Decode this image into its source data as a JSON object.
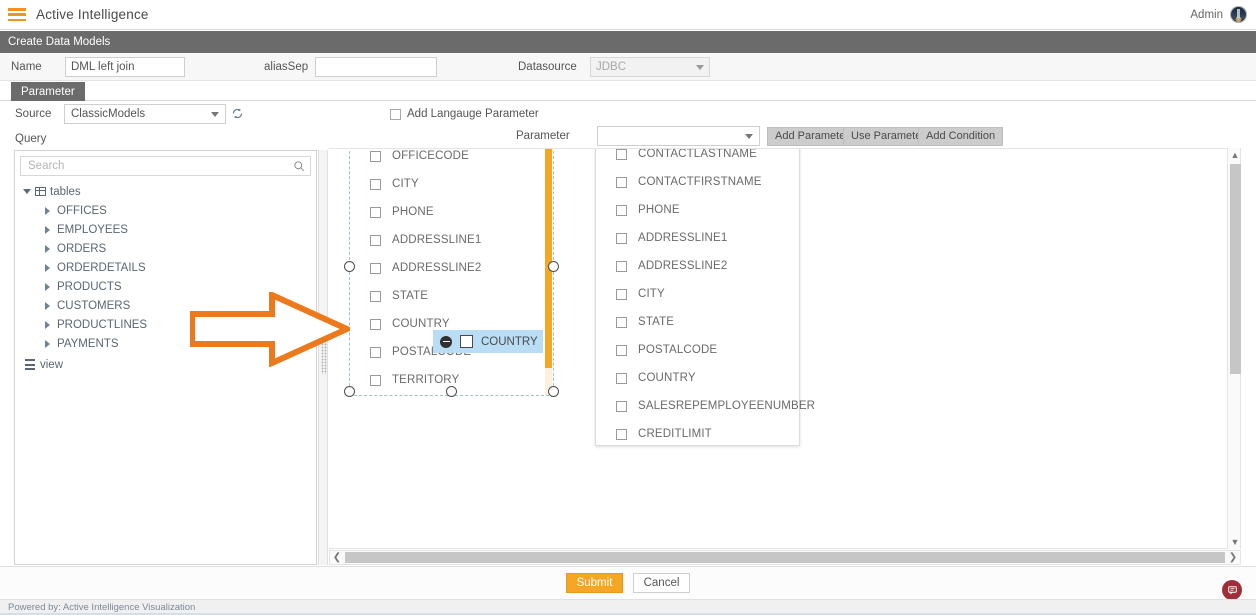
{
  "topbar": {
    "menu_icon": "hamburger-icon",
    "app_title": "Active Intelligence",
    "user_label": "Admin",
    "avatar_icon": "user-avatar"
  },
  "subheader": {
    "title": "Create Data Models"
  },
  "formrow": {
    "name_label": "Name",
    "name_value": "DML left join",
    "aliassep_label": "aliasSep",
    "aliassep_value": "",
    "aliassep_placeholder": "",
    "datasource_label": "Datasource",
    "datasource_value": "JDBC",
    "datasource_disabled": true
  },
  "tabs": {
    "active": "Parameter"
  },
  "band": {
    "source_label": "Source",
    "source_value": "ClassicModels",
    "refresh_icon": "refresh-icon",
    "query_label": "Query",
    "add_language_parameter_label": "Add Langauge Parameter",
    "add_language_parameter_checked": false,
    "parameter_label": "Parameter",
    "parameter_value": "",
    "buttons": [
      {
        "label": "Add Parameter"
      },
      {
        "label": "Use Parameter"
      },
      {
        "label": "Add Condition"
      }
    ]
  },
  "tree": {
    "search_placeholder": "Search",
    "search_value": "",
    "search_icon": "search-icon",
    "root": {
      "label": "tables",
      "icon": "table-icon",
      "expanded": true
    },
    "tables": [
      {
        "label": "OFFICES"
      },
      {
        "label": "EMPLOYEES"
      },
      {
        "label": "ORDERS"
      },
      {
        "label": "ORDERDETAILS"
      },
      {
        "label": "PRODUCTS"
      },
      {
        "label": "CUSTOMERS"
      },
      {
        "label": "PRODUCTLINES"
      },
      {
        "label": "PAYMENTS"
      }
    ],
    "view_node": {
      "label": "view",
      "icon": "view-icon"
    }
  },
  "canvas": {
    "panel1": {
      "selected": true,
      "fields": [
        {
          "label": "OFFICECODE",
          "checked": false
        },
        {
          "label": "CITY",
          "checked": false
        },
        {
          "label": "PHONE",
          "checked": false
        },
        {
          "label": "ADDRESSLINE1",
          "checked": false
        },
        {
          "label": "ADDRESSLINE2",
          "checked": false
        },
        {
          "label": "STATE",
          "checked": false
        },
        {
          "label": "COUNTRY",
          "checked": false
        },
        {
          "label": "POSTALCODE",
          "checked": false
        },
        {
          "label": "TERRITORY",
          "checked": false
        }
      ]
    },
    "panel2": {
      "selected": false,
      "fields": [
        {
          "label": "CONTACTLASTNAME",
          "checked": false
        },
        {
          "label": "CONTACTFIRSTNAME",
          "checked": false
        },
        {
          "label": "PHONE",
          "checked": false
        },
        {
          "label": "ADDRESSLINE1",
          "checked": false
        },
        {
          "label": "ADDRESSLINE2",
          "checked": false
        },
        {
          "label": "CITY",
          "checked": false
        },
        {
          "label": "STATE",
          "checked": false
        },
        {
          "label": "POSTALCODE",
          "checked": false
        },
        {
          "label": "COUNTRY",
          "checked": false
        },
        {
          "label": "SALESREPEMPLOYEENUMBER",
          "checked": false
        },
        {
          "label": "CREDITLIMIT",
          "checked": false
        }
      ]
    },
    "drag_ghost": {
      "label": "COUNTRY",
      "remove_icon": "minus-circle-icon",
      "checked": false
    },
    "annotation_arrow": {
      "icon": "arrow-right-annotation",
      "color": "#ec7a1c"
    }
  },
  "scrollbars": {
    "vertical_up_icon": "chevron-up-icon",
    "vertical_down_icon": "chevron-down-icon",
    "horizontal_left_icon": "chevron-left-icon",
    "horizontal_right_icon": "chevron-right-icon"
  },
  "footerbar": {
    "submit_label": "Submit",
    "cancel_label": "Cancel",
    "chat_icon": "chat-bubble-icon"
  },
  "footer": {
    "powered_by": "Powered by: Active Intelligence Visualization"
  },
  "colors": {
    "accent_orange": "#f5a623",
    "annotation_orange": "#ec7a1c",
    "header_gray": "#6b6b6b",
    "chat_red": "#9e2f38",
    "drag_highlight": "#b9ddf5"
  }
}
